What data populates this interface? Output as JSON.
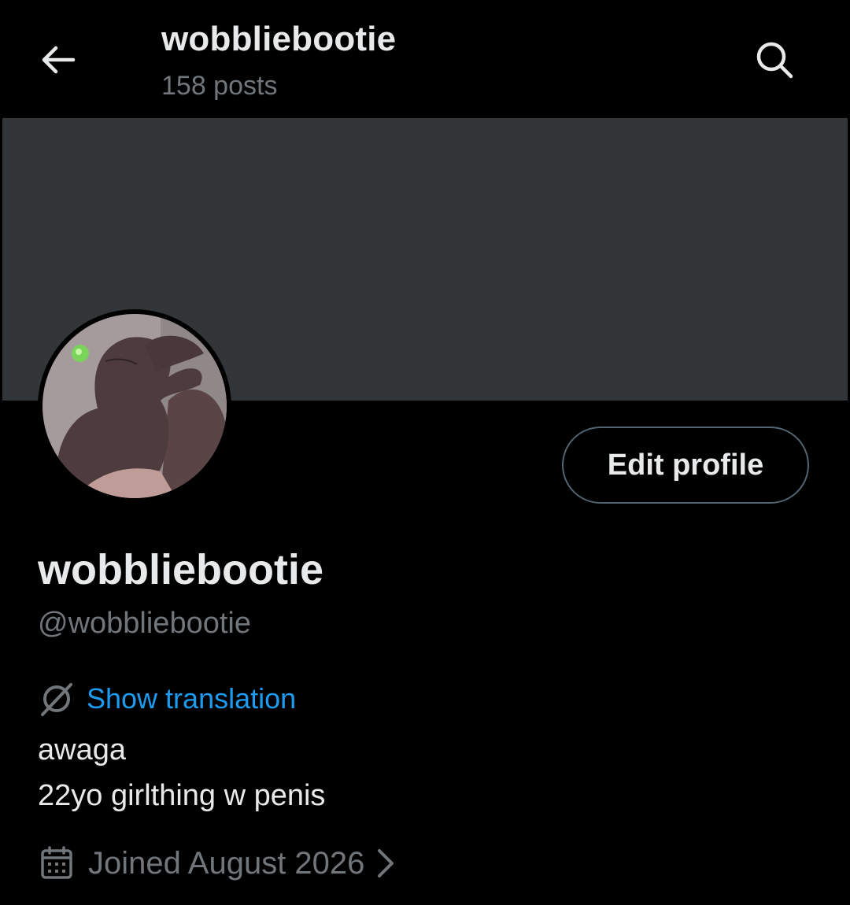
{
  "header": {
    "title": "wobbliebootie",
    "posts_count": "158 posts",
    "back_icon": "arrow-left-icon",
    "search_icon": "search-icon"
  },
  "banner": {
    "color": "#333639"
  },
  "profile": {
    "display_name": "wobbliebootie",
    "handle": "@wobbliebootie",
    "edit_button": "Edit profile",
    "translate_label": "Show translation",
    "bio_lines": [
      "awaga",
      "22yo girlthing w penis"
    ],
    "joined": "Joined August 2026"
  },
  "colors": {
    "background": "#000000",
    "primary_text": "#e7e9ea",
    "secondary_text": "#71767b",
    "link": "#1d9bf0",
    "border": "#536471"
  }
}
